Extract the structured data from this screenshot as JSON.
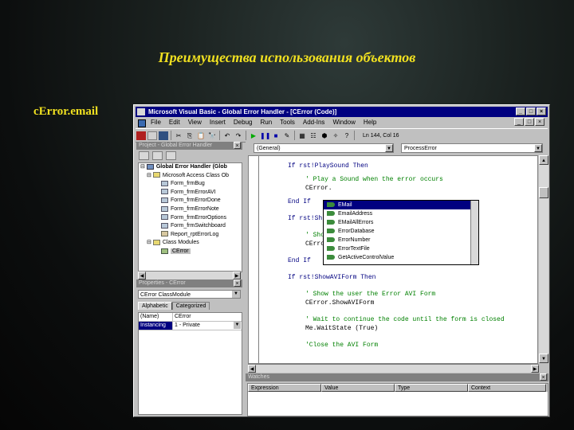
{
  "slide": {
    "title": "Преимущества использования объектов",
    "subtitle": "cError.email"
  },
  "window": {
    "title": "Microsoft Visual Basic - Global Error Handler - [CError (Code)]",
    "buttons": [
      "_",
      "□",
      "×"
    ],
    "inner_buttons": [
      "_",
      "□",
      "×"
    ]
  },
  "menu": [
    "File",
    "Edit",
    "View",
    "Insert",
    "Debug",
    "Run",
    "Tools",
    "Add-Ins",
    "Window",
    "Help"
  ],
  "toolbar": {
    "position": "Ln 144, Col 16"
  },
  "project": {
    "title": "Project - Global Error Handler",
    "root": "Global Error Handler (Glob",
    "group1": "Microsoft Access Class Ob",
    "forms": [
      "Form_frmBug",
      "Form_frmErrorAVI",
      "Form_frmErrorDone",
      "Form_frmErrorNote",
      "Form_frmErrorOptions",
      "Form_frmSwitchboard",
      "Report_rptErrorLog"
    ],
    "group2": "Class Modules",
    "class_item": "CError"
  },
  "properties": {
    "title": "Properties - CError",
    "object": "CError  ClassModule",
    "tab_alpha": "Alphabetic",
    "tab_cat": "Categorized",
    "rows": [
      {
        "key": "(Name)",
        "value": "CError"
      },
      {
        "key": "Instancing",
        "value": "1 - Private"
      }
    ]
  },
  "code": {
    "object_combo": "(General)",
    "proc_combo": "ProcessError",
    "lines": [
      {
        "text": "If rst!PlaySound Then",
        "indent": 0,
        "kind": "kw"
      },
      {
        "text": "' Play a Sound when the error occurs",
        "indent": 2,
        "kind": "cm"
      },
      {
        "text": "CError.",
        "indent": 2,
        "kind": "tx"
      },
      {
        "text": "End If",
        "indent": 0,
        "kind": "kw"
      },
      {
        "text": "If rst!Sh",
        "indent": 0,
        "kind": "kw"
      },
      {
        "text": "' Sho",
        "indent": 2,
        "kind": "cm"
      },
      {
        "text": "CErro",
        "indent": 2,
        "kind": "tx"
      },
      {
        "text": "End If",
        "indent": 0,
        "kind": "kw"
      },
      {
        "text": "If rst!ShowAVIForm Then",
        "indent": 0,
        "kind": "kw"
      },
      {
        "text": "' Show the user the Error AVI Form",
        "indent": 2,
        "kind": "cm"
      },
      {
        "text": "CError.ShowAVIForm",
        "indent": 2,
        "kind": "tx"
      },
      {
        "text": "' Wait to continue the code until the form is closed",
        "indent": 2,
        "kind": "cm"
      },
      {
        "text": "Me.WaitState (True)",
        "indent": 2,
        "kind": "tx"
      },
      {
        "text": "'Close the AVI Form",
        "indent": 2,
        "kind": "cm"
      }
    ]
  },
  "autocomplete": {
    "items": [
      "EMail",
      "EmailAddress",
      "EMailAllErrors",
      "ErrorDatabase",
      "ErrorNumber",
      "ErrorTextFile",
      "GetActiveControlValue"
    ],
    "selected_index": 0
  },
  "watches": {
    "title": "Watches",
    "columns": [
      "Expression",
      "Value",
      "Type",
      "Context"
    ]
  }
}
